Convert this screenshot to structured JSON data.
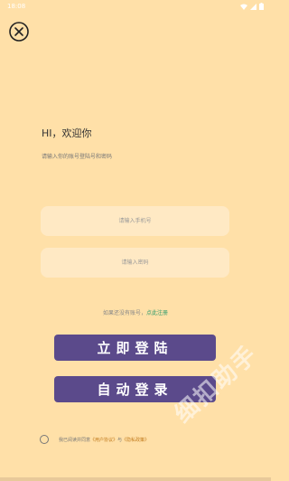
{
  "status_bar": {
    "time": "18:08"
  },
  "greeting": "HI，欢迎你",
  "subtitle": "请输入你的账号登陆号和密码",
  "phone": {
    "placeholder": "请输入手机号"
  },
  "password": {
    "placeholder": "请输入密码"
  },
  "register": {
    "prompt": "如果还没有账号，",
    "link": "点此注册"
  },
  "buttons": {
    "login": "立即登陆",
    "auto_login": "自动登录"
  },
  "watermark": "细扣助手",
  "agreement": {
    "prefix": "我已阅读并同意",
    "user_agreement": "《用户协议》",
    "and": "与",
    "privacy_policy": "《隐私政策》"
  },
  "colors": {
    "background": "#FFE0A8",
    "button": "#5B4A8B",
    "link_green": "#2b9a6b",
    "link_orange": "#C17A1C"
  }
}
